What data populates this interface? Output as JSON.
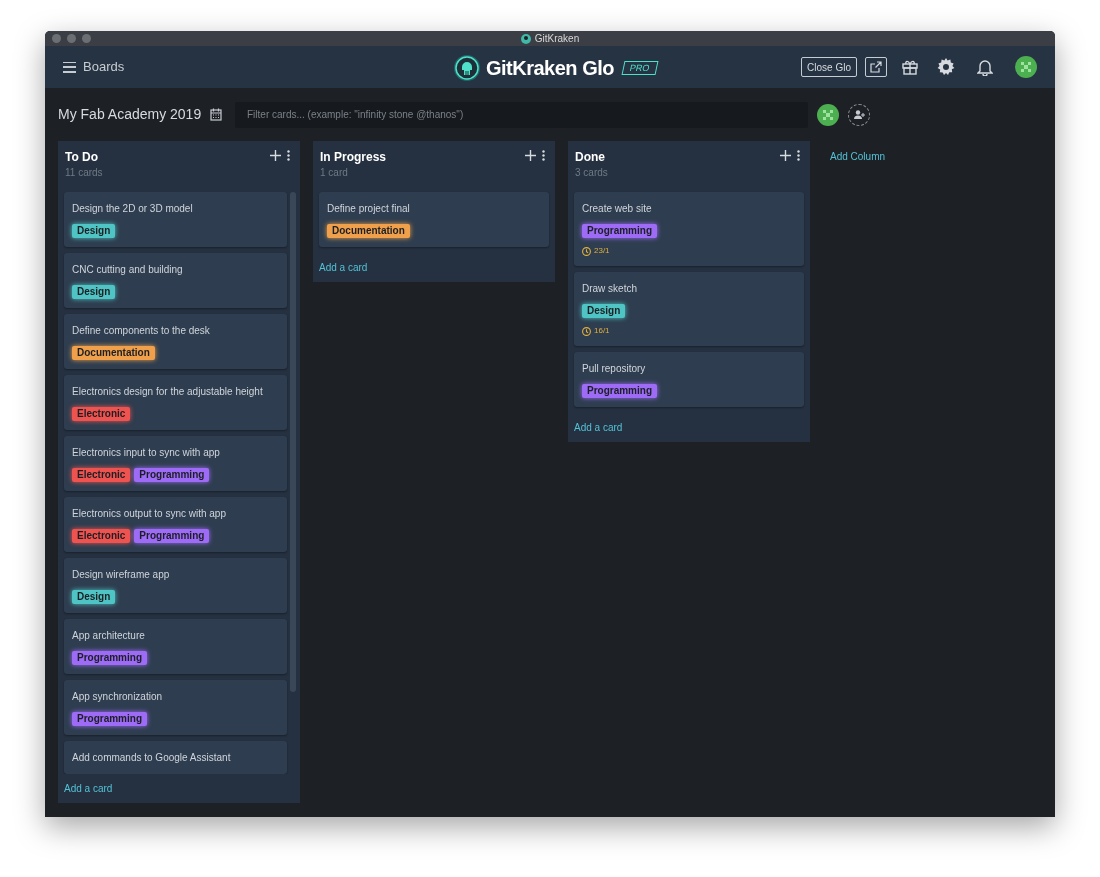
{
  "window": {
    "title": "GitKraken"
  },
  "header": {
    "menu_label": "Boards",
    "logo_text": "GitKraken Glo",
    "badge": "PRO",
    "close_button": "Close Glo"
  },
  "board": {
    "title": "My Fab Academy 2019",
    "filter": {
      "placeholder": "Filter cards... (example: \"infinity stone @thanos\")"
    }
  },
  "columns": [
    {
      "title": "To Do",
      "count": "11 cards",
      "add_card": "Add a card",
      "cards": [
        {
          "title": "Design the 2D or 3D model",
          "labels": [
            {
              "text": "Design",
              "color": "#4fc4c4"
            }
          ]
        },
        {
          "title": "CNC cutting and building",
          "labels": [
            {
              "text": "Design",
              "color": "#4fc4c4"
            }
          ]
        },
        {
          "title": "Define components to the desk",
          "labels": [
            {
              "text": "Documentation",
              "color": "#f0a04b"
            }
          ]
        },
        {
          "title": "Electronics design for the adjustable height",
          "labels": [
            {
              "text": "Electronic",
              "color": "#ef5350"
            }
          ]
        },
        {
          "title": "Electronics input to sync with app",
          "labels": [
            {
              "text": "Electronic",
              "color": "#ef5350"
            },
            {
              "text": "Programming",
              "color": "#9d6bf5"
            }
          ]
        },
        {
          "title": "Electronics output to sync with app",
          "labels": [
            {
              "text": "Electronic",
              "color": "#ef5350"
            },
            {
              "text": "Programming",
              "color": "#9d6bf5"
            }
          ]
        },
        {
          "title": "Design wireframe app",
          "labels": [
            {
              "text": "Design",
              "color": "#4fc4c4"
            }
          ]
        },
        {
          "title": "App architecture",
          "labels": [
            {
              "text": "Programming",
              "color": "#9d6bf5"
            }
          ]
        },
        {
          "title": "App synchronization",
          "labels": [
            {
              "text": "Programming",
              "color": "#9d6bf5"
            }
          ]
        },
        {
          "title": "Add commands to Google Assistant"
        }
      ]
    },
    {
      "title": "In Progress",
      "count": "1 card",
      "add_card": "Add a card",
      "cards": [
        {
          "title": "Define project final",
          "labels": [
            {
              "text": "Documentation",
              "color": "#f0a04b"
            }
          ]
        }
      ]
    },
    {
      "title": "Done",
      "count": "3 cards",
      "add_card": "Add a card",
      "cards": [
        {
          "title": "Create web site",
          "labels": [
            {
              "text": "Programming",
              "color": "#9d6bf5"
            }
          ],
          "due": "23/1"
        },
        {
          "title": "Draw sketch",
          "labels": [
            {
              "text": "Design",
              "color": "#4fc4c4"
            }
          ],
          "due": "16/1"
        },
        {
          "title": "Pull repository",
          "labels": [
            {
              "text": "Programming",
              "color": "#9d6bf5"
            }
          ]
        }
      ]
    }
  ],
  "add_column": "Add Column"
}
